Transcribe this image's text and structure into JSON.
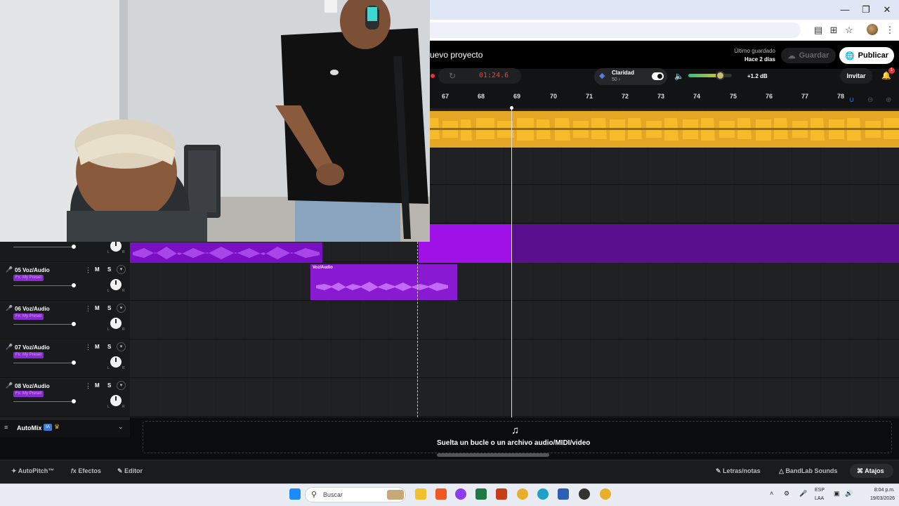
{
  "header": {
    "project_title": "uevo proyecto",
    "last_saved_label": "Último guardado",
    "last_saved_value": "Hace 2 días",
    "save_label": "Guardar",
    "publish_label": "Publicar"
  },
  "transport": {
    "time": "01:24.6",
    "clarity_label": "Claridad",
    "clarity_value": "50",
    "volume_level": 0.72,
    "volume_db": "+1.2 dB",
    "invite_label": "Invitar",
    "notifications_count": "1"
  },
  "ruler": {
    "ticks": [
      "67",
      "68",
      "69",
      "70",
      "71",
      "72",
      "73",
      "74",
      "75",
      "76",
      "77",
      "78"
    ]
  },
  "tracks": [
    {
      "name": "05  Voz/Audio",
      "m": "M",
      "s": "S",
      "fx": "Fx: My Preset"
    },
    {
      "name": "06  Voz/Audio",
      "m": "M",
      "s": "S",
      "fx": "Fx: My Preset"
    },
    {
      "name": "07  Voz/Audio",
      "m": "M",
      "s": "S",
      "fx": "Fx: My Preset"
    },
    {
      "name": "08  Voz/Audio",
      "m": "M",
      "s": "S",
      "fx": "Fx: My Preset"
    }
  ],
  "clips": {
    "track05_label": "Voz/Audio"
  },
  "automix": {
    "label": "AutoMix",
    "badge": "IA"
  },
  "dropzone": {
    "text": "Suelta un bucle o un archivo audio/MIDI/video"
  },
  "bottombar": {
    "autopitch": "AutoPitch™",
    "effects": "Efectos",
    "editor": "Editor",
    "lyrics": "Letras/notas",
    "sounds": "BandLab Sounds",
    "shortcuts": "Atajos"
  },
  "taskbar": {
    "search_placeholder": "Buscar",
    "lang_line1": "ESP",
    "lang_line2": "LAA",
    "time": "8:04 p.m.",
    "date": "19/03/2026"
  },
  "colors": {
    "accent_purple": "#8a1ad1",
    "clip_orange": "#e4a624",
    "record_red": "#f0443a"
  }
}
